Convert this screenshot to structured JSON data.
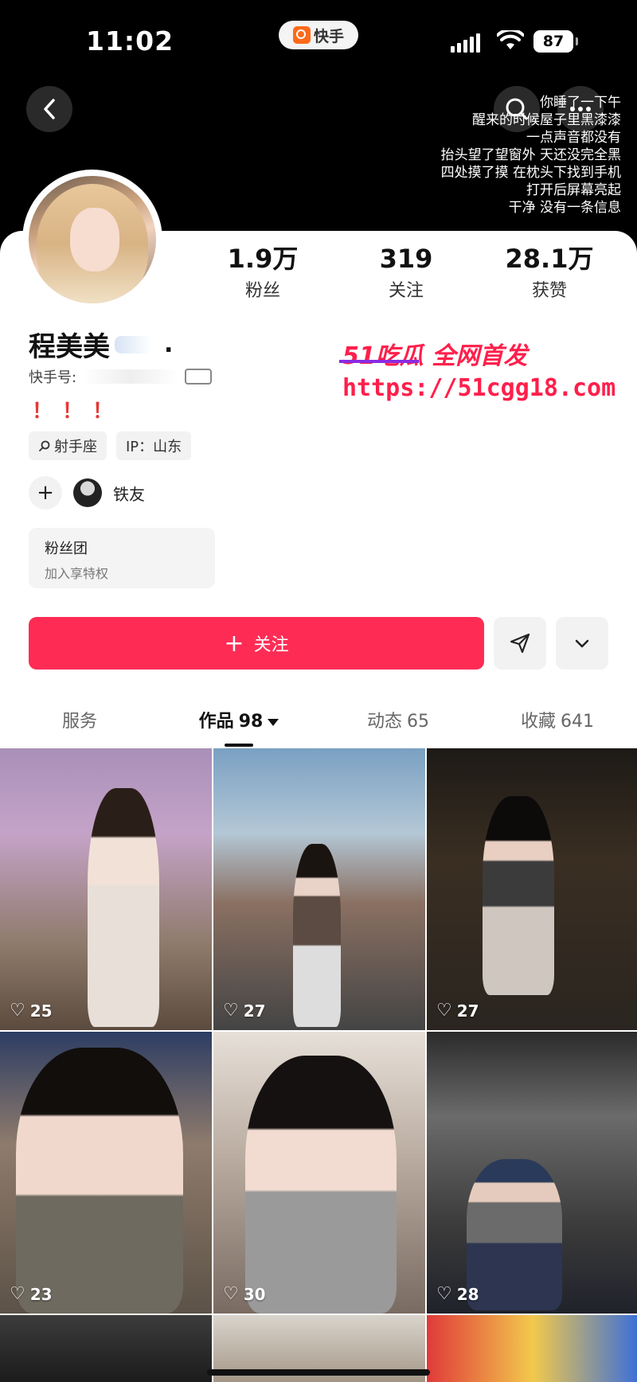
{
  "status_bar": {
    "time": "11:02",
    "app_name": "快手",
    "battery": "87"
  },
  "header": {
    "poem_lines": [
      "你睡了一下午",
      "醒来的时候屋子里黑漆漆",
      "一点声音都没有",
      "抬头望了望窗外 天还没完全黑",
      "四处摸了摸 在枕头下找到手机",
      "打开后屏幕亮起",
      "干净 没有一条信息"
    ]
  },
  "profile": {
    "name": "程美美",
    "name_suffix": ".",
    "kwai_id_label": "快手号:",
    "bio": "！！！",
    "tags": [
      {
        "icon": "search-icon",
        "label": "射手座"
      },
      {
        "label": "IP：山东"
      }
    ],
    "friend_label": "铁友",
    "fan_club": {
      "title": "粉丝团",
      "subtitle": "加入享特权"
    },
    "follow_label": "关注"
  },
  "stats": [
    {
      "value": "1.9万",
      "label": "粉丝"
    },
    {
      "value": "319",
      "label": "关注"
    },
    {
      "value": "28.1万",
      "label": "获赞"
    }
  ],
  "tabs": [
    {
      "label": "服务",
      "count": ""
    },
    {
      "label": "作品",
      "count": "98"
    },
    {
      "label": "动态",
      "count": "65"
    },
    {
      "label": "收藏",
      "count": "641"
    }
  ],
  "watermark": {
    "top": "51吃瓜 全网首发",
    "url": "https://51cgg18.com"
  },
  "grid": [
    {
      "likes": "25"
    },
    {
      "likes": "27"
    },
    {
      "likes": "27"
    },
    {
      "likes": "23"
    },
    {
      "likes": "30"
    },
    {
      "likes": "28"
    },
    {
      "likes": ""
    },
    {
      "likes": ""
    },
    {
      "likes": ""
    }
  ]
}
